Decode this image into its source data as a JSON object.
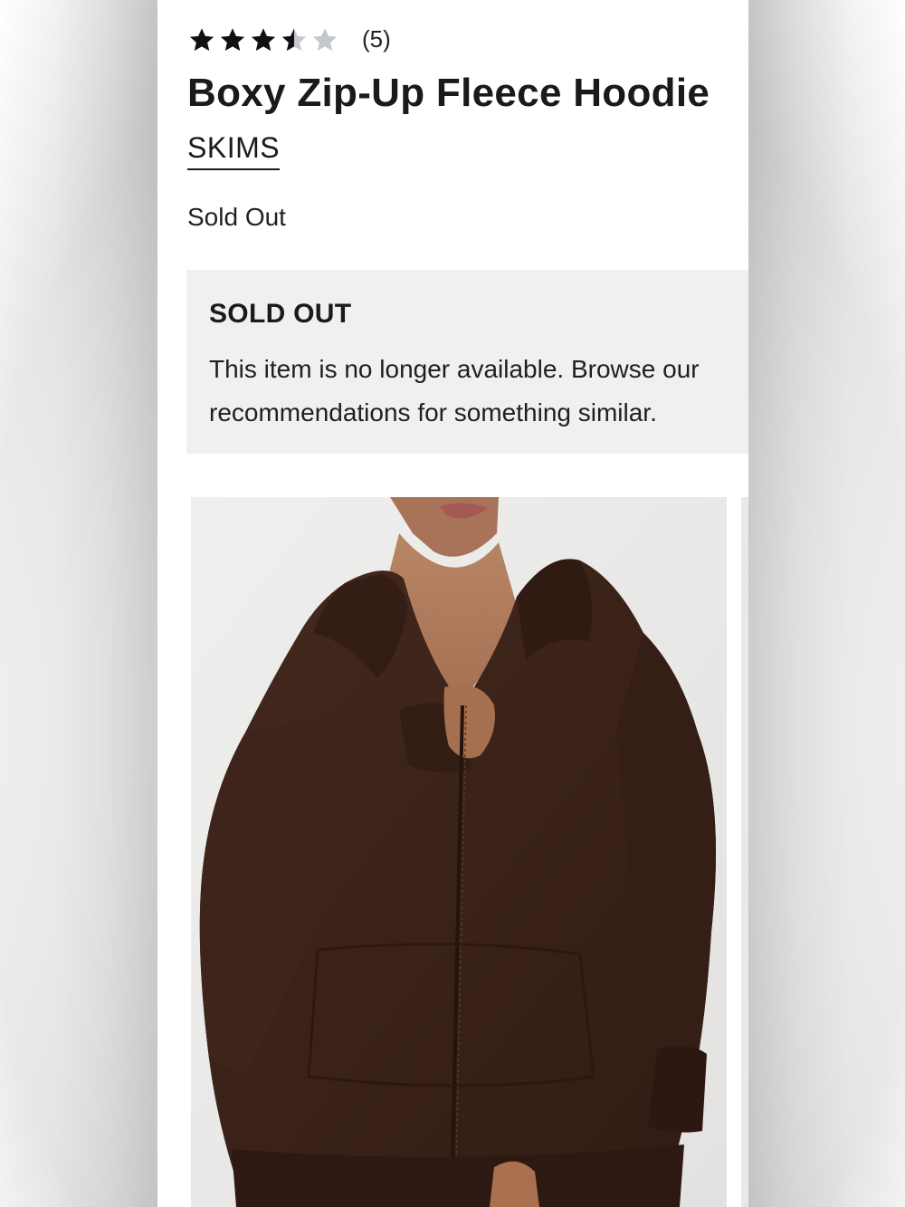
{
  "product": {
    "rating": {
      "value": 3.5,
      "max": 5,
      "count_label": "(5)"
    },
    "title": "Boxy Zip-Up Fleece Hoodie",
    "brand": "SKIMS",
    "status": "Sold Out"
  },
  "notice": {
    "heading": "SOLD OUT",
    "body": "This item is no longer available. Browse our recommendations for something similar."
  },
  "gallery": {
    "images": [
      {
        "description_icon": "product-photo",
        "garment_color": "#3a2419"
      }
    ]
  },
  "colors": {
    "filled_star": "#111111",
    "empty_star": "#c3c8cc",
    "notice_bg": "#eff0f2",
    "text": "#1a1a1a"
  }
}
